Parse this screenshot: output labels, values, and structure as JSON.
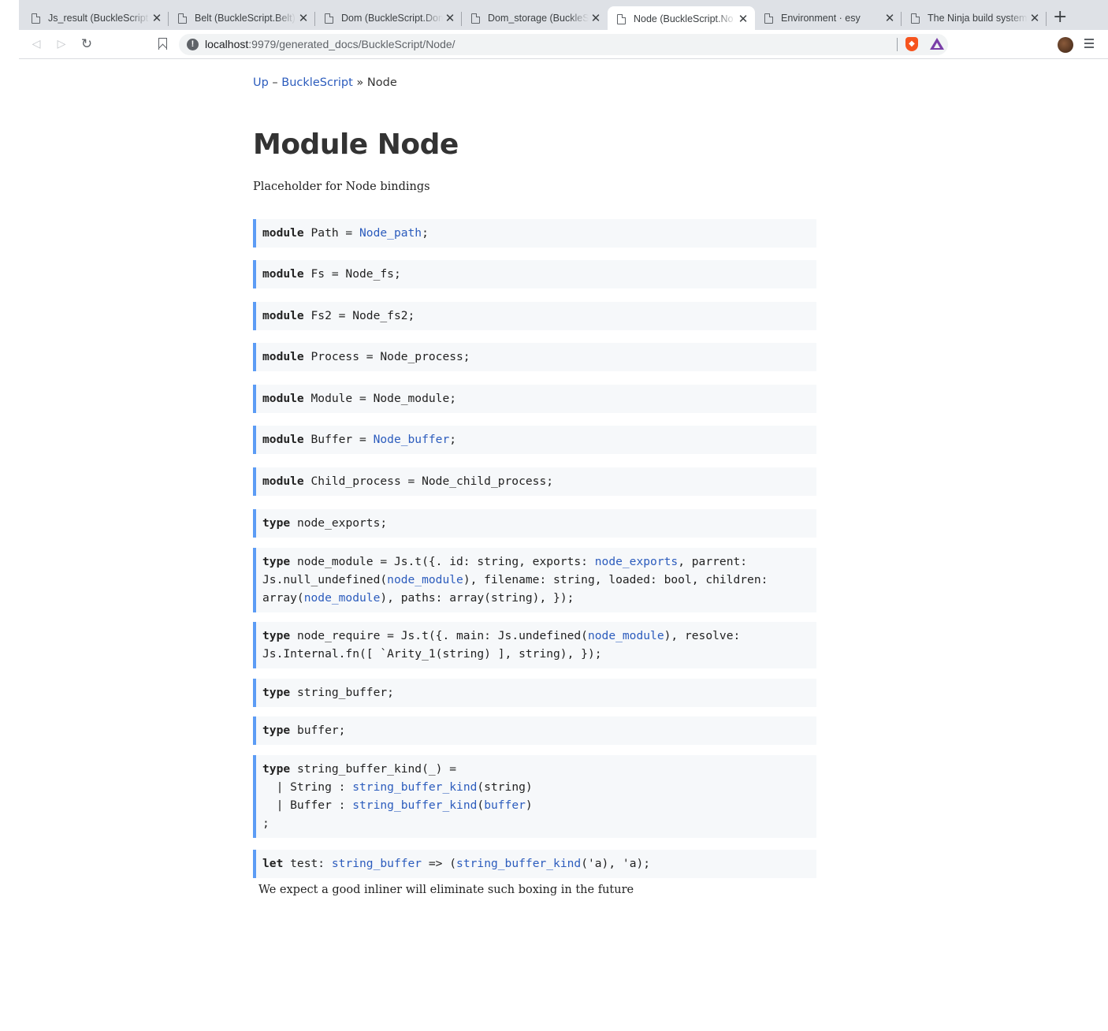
{
  "browser": {
    "tabs": [
      {
        "title": "Js_result (BuckleScript.",
        "active": false
      },
      {
        "title": "Belt (BuckleScript.Belt)",
        "active": false
      },
      {
        "title": "Dom (BuckleScript.Dom",
        "active": false
      },
      {
        "title": "Dom_storage (BuckleS",
        "active": false
      },
      {
        "title": "Node (BuckleScript.No",
        "active": true
      },
      {
        "title": "Environment · esy",
        "active": false
      },
      {
        "title": "The Ninja build system",
        "active": false
      }
    ],
    "close_glyph": "✕",
    "new_tab_glyph": "+",
    "url_host": "localhost",
    "url_rest": ":9979/generated_docs/BuckleScript/Node/"
  },
  "page": {
    "breadcrumb": {
      "up": "Up",
      "dash": " – ",
      "parent": "BuckleScript",
      "sep": " » ",
      "current": "Node"
    },
    "title": "Module Node",
    "preamble": "Placeholder for Node bindings",
    "specs": [
      {
        "parts": [
          {
            "k": "kw",
            "t": "module"
          },
          {
            "t": " Path = "
          },
          {
            "k": "link",
            "t": "Node_path"
          },
          {
            "t": ";"
          }
        ]
      },
      {
        "parts": [
          {
            "k": "kw",
            "t": "module"
          },
          {
            "t": " Fs = Node_fs;"
          }
        ]
      },
      {
        "parts": [
          {
            "k": "kw",
            "t": "module"
          },
          {
            "t": " Fs2 = Node_fs2;"
          }
        ]
      },
      {
        "parts": [
          {
            "k": "kw",
            "t": "module"
          },
          {
            "t": " Process = Node_process;"
          }
        ]
      },
      {
        "parts": [
          {
            "k": "kw",
            "t": "module"
          },
          {
            "t": " Module = Node_module;"
          }
        ]
      },
      {
        "parts": [
          {
            "k": "kw",
            "t": "module"
          },
          {
            "t": " Buffer = "
          },
          {
            "k": "link",
            "t": "Node_buffer"
          },
          {
            "t": ";"
          }
        ]
      },
      {
        "parts": [
          {
            "k": "kw",
            "t": "module"
          },
          {
            "t": " Child_process = Node_child_process;"
          }
        ]
      },
      {
        "parts": [
          {
            "k": "kw",
            "t": "type"
          },
          {
            "t": " node_exports;"
          }
        ]
      },
      {
        "parts": [
          {
            "k": "kw",
            "t": "type"
          },
          {
            "t": " node_module = Js.t({. id: string, exports: "
          },
          {
            "k": "link",
            "t": "node_exports"
          },
          {
            "t": ", parrent:\nJs.null_undefined("
          },
          {
            "k": "link",
            "t": "node_module"
          },
          {
            "t": "), filename: string, loaded: bool, children:\narray("
          },
          {
            "k": "link",
            "t": "node_module"
          },
          {
            "t": "), paths: array(string), });"
          }
        ]
      },
      {
        "parts": [
          {
            "k": "kw",
            "t": "type"
          },
          {
            "t": " node_require = Js.t({. main: Js.undefined("
          },
          {
            "k": "link",
            "t": "node_module"
          },
          {
            "t": "), resolve:\nJs.Internal.fn([ `Arity_1(string) ], string), });"
          }
        ]
      },
      {
        "parts": [
          {
            "k": "kw",
            "t": "type"
          },
          {
            "t": " string_buffer;"
          }
        ]
      },
      {
        "parts": [
          {
            "k": "kw",
            "t": "type"
          },
          {
            "t": " buffer;"
          }
        ]
      },
      {
        "parts": [
          {
            "k": "kw",
            "t": "type"
          },
          {
            "t": " string_buffer_kind(_) =\n  | String : "
          },
          {
            "k": "link",
            "t": "string_buffer_kind"
          },
          {
            "t": "(string)\n  | Buffer : "
          },
          {
            "k": "link",
            "t": "string_buffer_kind"
          },
          {
            "t": "("
          },
          {
            "k": "link",
            "t": "buffer"
          },
          {
            "t": ")\n;"
          }
        ]
      },
      {
        "parts": [
          {
            "k": "kw",
            "t": "let"
          },
          {
            "t": " test: "
          },
          {
            "k": "link",
            "t": "string_buffer"
          },
          {
            "t": " => ("
          },
          {
            "k": "link",
            "t": "string_buffer_kind"
          },
          {
            "t": "('a), 'a);"
          }
        ]
      }
    ],
    "test_doc": "We expect a good inliner will eliminate such boxing in the future"
  }
}
